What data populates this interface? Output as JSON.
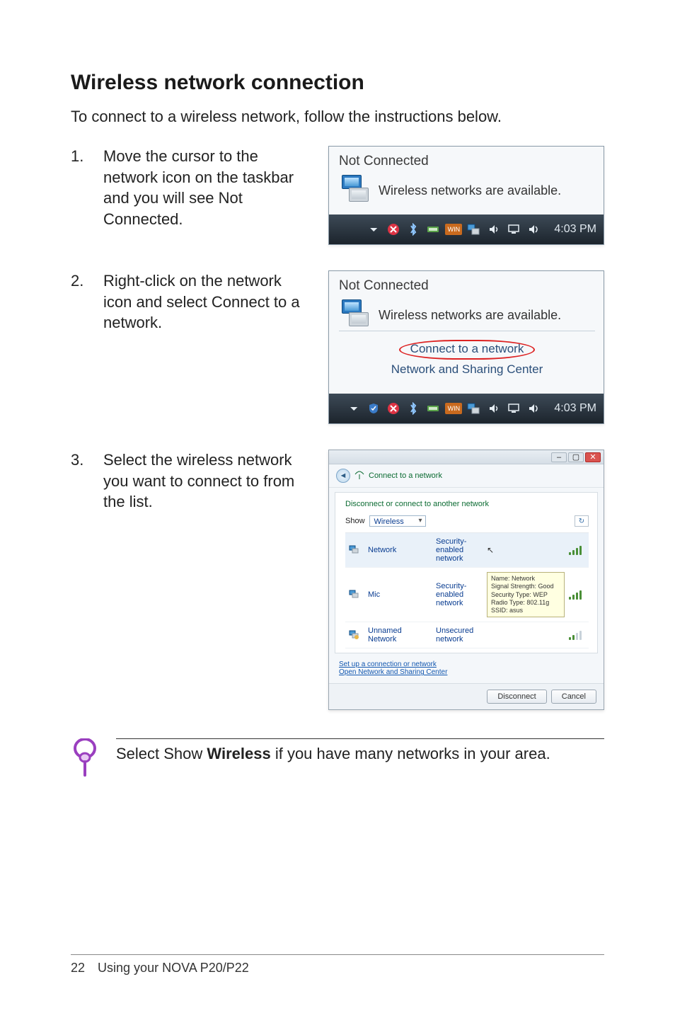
{
  "section_title": "Wireless network connection",
  "intro": "To connect to a wireless network, follow the instructions below.",
  "steps": [
    {
      "num": "1.",
      "text": "Move the cursor to the network icon on the taskbar and you will see Not Connected."
    },
    {
      "num": "2.",
      "text": "Right-click on the network icon and select Connect to a network."
    },
    {
      "num": "3.",
      "text": "Select the wireless network you want to connect to from the list."
    }
  ],
  "popup1": {
    "title": "Not Connected",
    "message": "Wireless networks are available.",
    "clock": "4:03 PM"
  },
  "popup2": {
    "title": "Not Connected",
    "message": "Wireless networks are available.",
    "menu_connect": "Connect to a network",
    "menu_sharing": "Network and Sharing Center",
    "clock": "4:03 PM"
  },
  "dialog": {
    "header": "Connect to a network",
    "subheader": "Disconnect or connect to another network",
    "show_label": "Show",
    "show_value": "Wireless",
    "networks": [
      {
        "name": "Network",
        "security": "Security-enabled network",
        "selected": true,
        "strength": "full",
        "tooltip_cursor": true
      },
      {
        "name": "Mic",
        "security": "Security-enabled network",
        "selected": false,
        "strength": "full",
        "tooltip": {
          "l1": "Name: Network",
          "l2": "Signal Strength: Good",
          "l3": "Security Type: WEP",
          "l4": "Radio Type: 802.11g",
          "l5": "SSID: asus"
        }
      },
      {
        "name": "Unnamed Network",
        "security": "Unsecured network",
        "selected": false,
        "strength": "low"
      }
    ],
    "link_setup": "Set up a connection or network",
    "link_open": "Open Network and Sharing Center",
    "btn_disconnect": "Disconnect",
    "btn_cancel": "Cancel"
  },
  "note": {
    "prefix": "Select Show ",
    "bold": "Wireless",
    "suffix": " if you have many networks in your area."
  },
  "footer": {
    "page": "22",
    "chapter": "Using your NOVA P20/P22"
  }
}
